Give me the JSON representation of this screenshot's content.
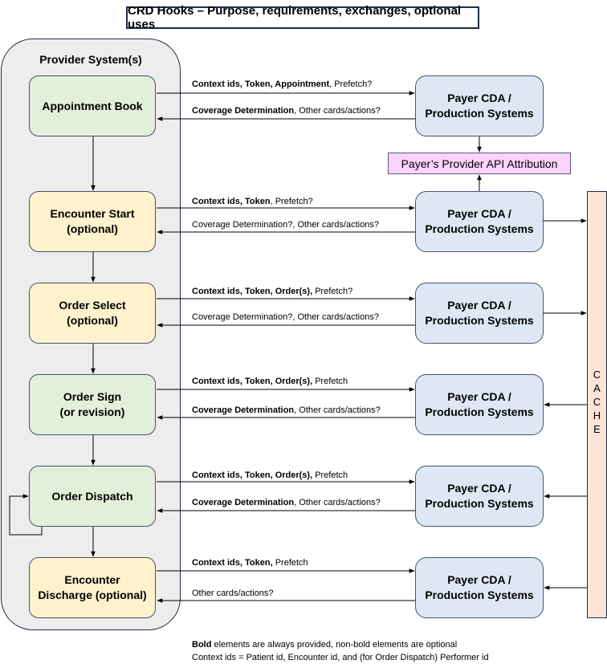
{
  "title": "CRD Hooks – Purpose, requirements, exchanges, optional uses",
  "provider": {
    "title": "Provider System(s)",
    "hooks": [
      {
        "lines": [
          "Appointment Book"
        ],
        "style": "green"
      },
      {
        "lines": [
          "Encounter Start",
          "(optional)"
        ],
        "style": "yellow"
      },
      {
        "lines": [
          "Order Select",
          "(optional)"
        ],
        "style": "yellow"
      },
      {
        "lines": [
          "Order Sign",
          "(or revision)"
        ],
        "style": "green"
      },
      {
        "lines": [
          "Order Dispatch"
        ],
        "style": "green"
      },
      {
        "lines": [
          "Encounter",
          "Discharge (optional)"
        ],
        "style": "yellow"
      }
    ]
  },
  "payer": {
    "lines": [
      "Payer CDA /",
      "Production Systems"
    ]
  },
  "attribution": "Payer’s Provider API Attribution",
  "cache": {
    "label": "CACHE",
    "letters": [
      "C",
      "A",
      "C",
      "H",
      "E"
    ]
  },
  "exchanges": [
    {
      "request": {
        "bold": "Context ids, Token, Appointment",
        "normal": ", Prefetch?"
      },
      "response": {
        "bold": "Coverage Determination",
        "normal": ", Other cards/actions?"
      }
    },
    {
      "request": {
        "bold": "Context ids, Token",
        "normal": ", Prefetch?"
      },
      "response": {
        "bold": "",
        "normal": "Coverage Determination?, Other cards/actions?"
      }
    },
    {
      "request": {
        "bold": "Context ids, Token, Order(s),",
        "normal": " Prefetch?"
      },
      "response": {
        "bold": "",
        "normal": "Coverage Determination?, Other cards/actions?"
      }
    },
    {
      "request": {
        "bold": "Context ids, Token, Order(s),",
        "normal": " Prefetch"
      },
      "response": {
        "bold": "Coverage Determination",
        "normal": ", Other cards/actions?"
      }
    },
    {
      "request": {
        "bold": "Context ids, Token, Order(s),",
        "normal": " Prefetch"
      },
      "response": {
        "bold": "Coverage Determination",
        "normal": ", Other cards/actions?"
      }
    },
    {
      "request": {
        "bold": "Context ids, Token,",
        "normal": " Prefetch"
      },
      "response": {
        "bold": "",
        "normal": "Other cards/actions?"
      }
    }
  ],
  "cache_flow": [
    "none",
    "to-cache",
    "to-cache",
    "from-cache",
    "from-cache",
    "from-cache"
  ],
  "footnotes": {
    "line1_bold": "Bold",
    "line1_rest": " elements are always provided, non-bold elements are optional",
    "line2": "Context ids = Patient id, Encounter id, and (for Order Dispatch) Performer id"
  }
}
